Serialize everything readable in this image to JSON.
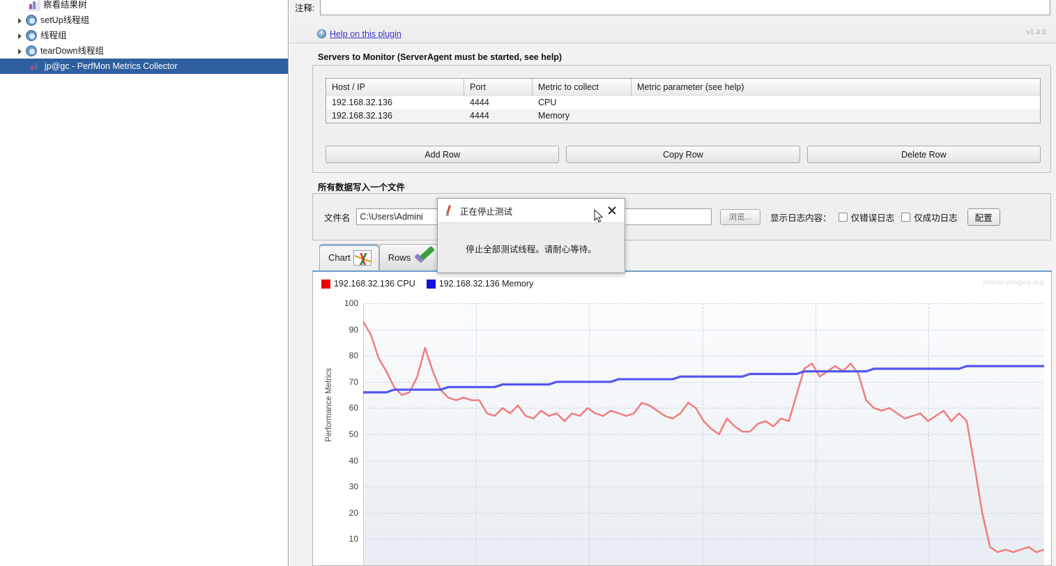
{
  "tree": {
    "items": [
      {
        "label": "察看结果树",
        "icon": "results-tree-icon",
        "expandable": false,
        "selected": false,
        "indent": 40
      },
      {
        "label": "setUp线程组",
        "icon": "thread-group-icon",
        "expandable": true,
        "selected": false,
        "indent": 22
      },
      {
        "label": "线程组",
        "icon": "thread-group-icon",
        "expandable": true,
        "selected": false,
        "indent": 22
      },
      {
        "label": "tearDown线程组",
        "icon": "thread-group-icon",
        "expandable": true,
        "selected": false,
        "indent": 22
      },
      {
        "label": "jp@gc - PerfMon Metrics Collector",
        "icon": "perfmon-icon",
        "expandable": false,
        "selected": true,
        "indent": 42
      }
    ]
  },
  "comment": {
    "label": "注释:",
    "value": "",
    "placeholder": ""
  },
  "help": {
    "link_text": "Help on this plugin",
    "icon": "info-icon",
    "version": "v1.4.0"
  },
  "servers": {
    "title": "Servers to Monitor (ServerAgent must be started, see help)",
    "columns": [
      "Host / IP",
      "Port",
      "Metric to collect",
      "Metric parameter (see help)"
    ],
    "rows": [
      {
        "host": "192.168.32.136",
        "port": "4444",
        "metric": "CPU",
        "parameter": ""
      },
      {
        "host": "192.168.32.136",
        "port": "4444",
        "metric": "Memory",
        "parameter": ""
      }
    ],
    "buttons": [
      "Add Row",
      "Copy Row",
      "Delete Row"
    ]
  },
  "file_section": {
    "title": "所有数据写入一个文件",
    "filename_label": "文件名",
    "filename_value": "C:\\Users\\Admini",
    "browse_label": "浏览...",
    "log_label": "显示日志内容：",
    "checkbox_error": "仅错误日志",
    "checkbox_success": "仅成功日志",
    "config_label": "配置"
  },
  "tabs": [
    {
      "label": "Chart",
      "icon": "chart-icon",
      "active": true
    },
    {
      "label": "Rows",
      "icon": "check-icon",
      "active": false
    }
  ],
  "dialog": {
    "title": "正在停止测试",
    "body": "停止全部测试线程。请耐心等待。",
    "icon": "jmeter-feather-icon",
    "close_icon": "close-icon"
  },
  "chart_panel": {
    "watermark": "jmeter-plugins.org"
  },
  "chart_data": {
    "type": "line",
    "title": "",
    "xlabel": "",
    "ylabel": "Performance Metrics",
    "ylim": [
      0,
      100
    ],
    "yticks": [
      100,
      90,
      80,
      70,
      60,
      50,
      40,
      30,
      20,
      10
    ],
    "grid": true,
    "legend_position": "top-left",
    "colors": {
      "cpu": "#ef4444",
      "memory": "#2222dd"
    },
    "series": [
      {
        "name": "192.168.32.136 CPU",
        "color": "#f08080",
        "values": [
          93,
          88,
          79,
          74,
          68,
          65,
          66,
          72,
          83,
          74,
          67,
          64,
          63,
          64,
          63,
          63,
          58,
          57,
          60,
          58,
          61,
          57,
          56,
          59,
          57,
          58,
          55,
          58,
          57,
          60,
          58,
          57,
          59,
          58,
          57,
          58,
          62,
          61,
          59,
          57,
          56,
          58,
          62,
          60,
          55,
          52,
          50,
          56,
          53,
          51,
          51,
          54,
          55,
          53,
          56,
          55,
          65,
          75,
          77,
          72,
          74,
          76,
          74,
          77,
          73,
          63,
          60,
          59,
          60,
          58,
          56,
          57,
          58,
          55,
          57,
          59,
          55,
          58,
          55,
          38,
          20,
          7,
          5,
          6,
          5,
          6,
          7,
          5,
          6
        ]
      },
      {
        "name": "192.168.32.136 Memory",
        "color": "#5555ee",
        "values": [
          66,
          66,
          66,
          66,
          67,
          67,
          67,
          67,
          67,
          67,
          67,
          68,
          68,
          68,
          68,
          68,
          68,
          68,
          69,
          69,
          69,
          69,
          69,
          69,
          69,
          70,
          70,
          70,
          70,
          70,
          70,
          70,
          70,
          71,
          71,
          71,
          71,
          71,
          71,
          71,
          71,
          72,
          72,
          72,
          72,
          72,
          72,
          72,
          72,
          72,
          73,
          73,
          73,
          73,
          73,
          73,
          73,
          74,
          74,
          74,
          74,
          74,
          74,
          74,
          74,
          74,
          75,
          75,
          75,
          75,
          75,
          75,
          75,
          75,
          75,
          75,
          75,
          75,
          76,
          76,
          76,
          76,
          76,
          76,
          76,
          76,
          76,
          76,
          76
        ]
      }
    ]
  }
}
